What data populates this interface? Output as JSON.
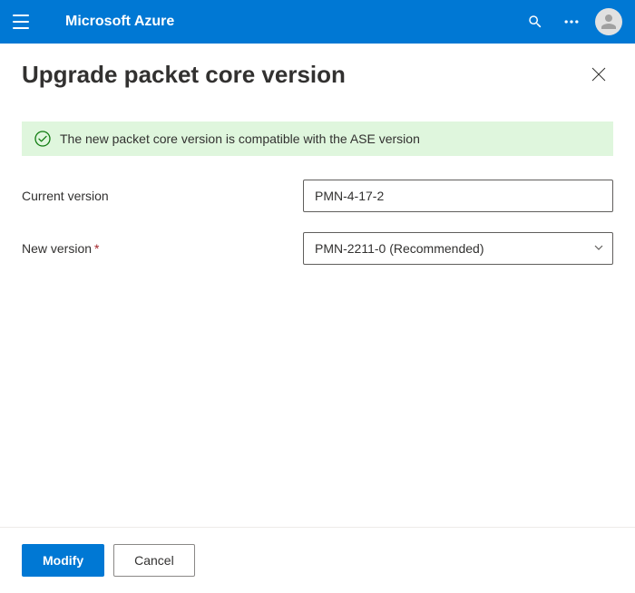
{
  "header": {
    "brand": "Microsoft Azure"
  },
  "panel": {
    "title": "Upgrade packet core version"
  },
  "status": {
    "message": "The new packet core version is compatible with the ASE version"
  },
  "form": {
    "current_version": {
      "label": "Current version",
      "value": "PMN-4-17-2"
    },
    "new_version": {
      "label": "New version",
      "required_marker": "*",
      "selected": "PMN-2211-0 (Recommended)"
    }
  },
  "footer": {
    "modify": "Modify",
    "cancel": "Cancel"
  }
}
